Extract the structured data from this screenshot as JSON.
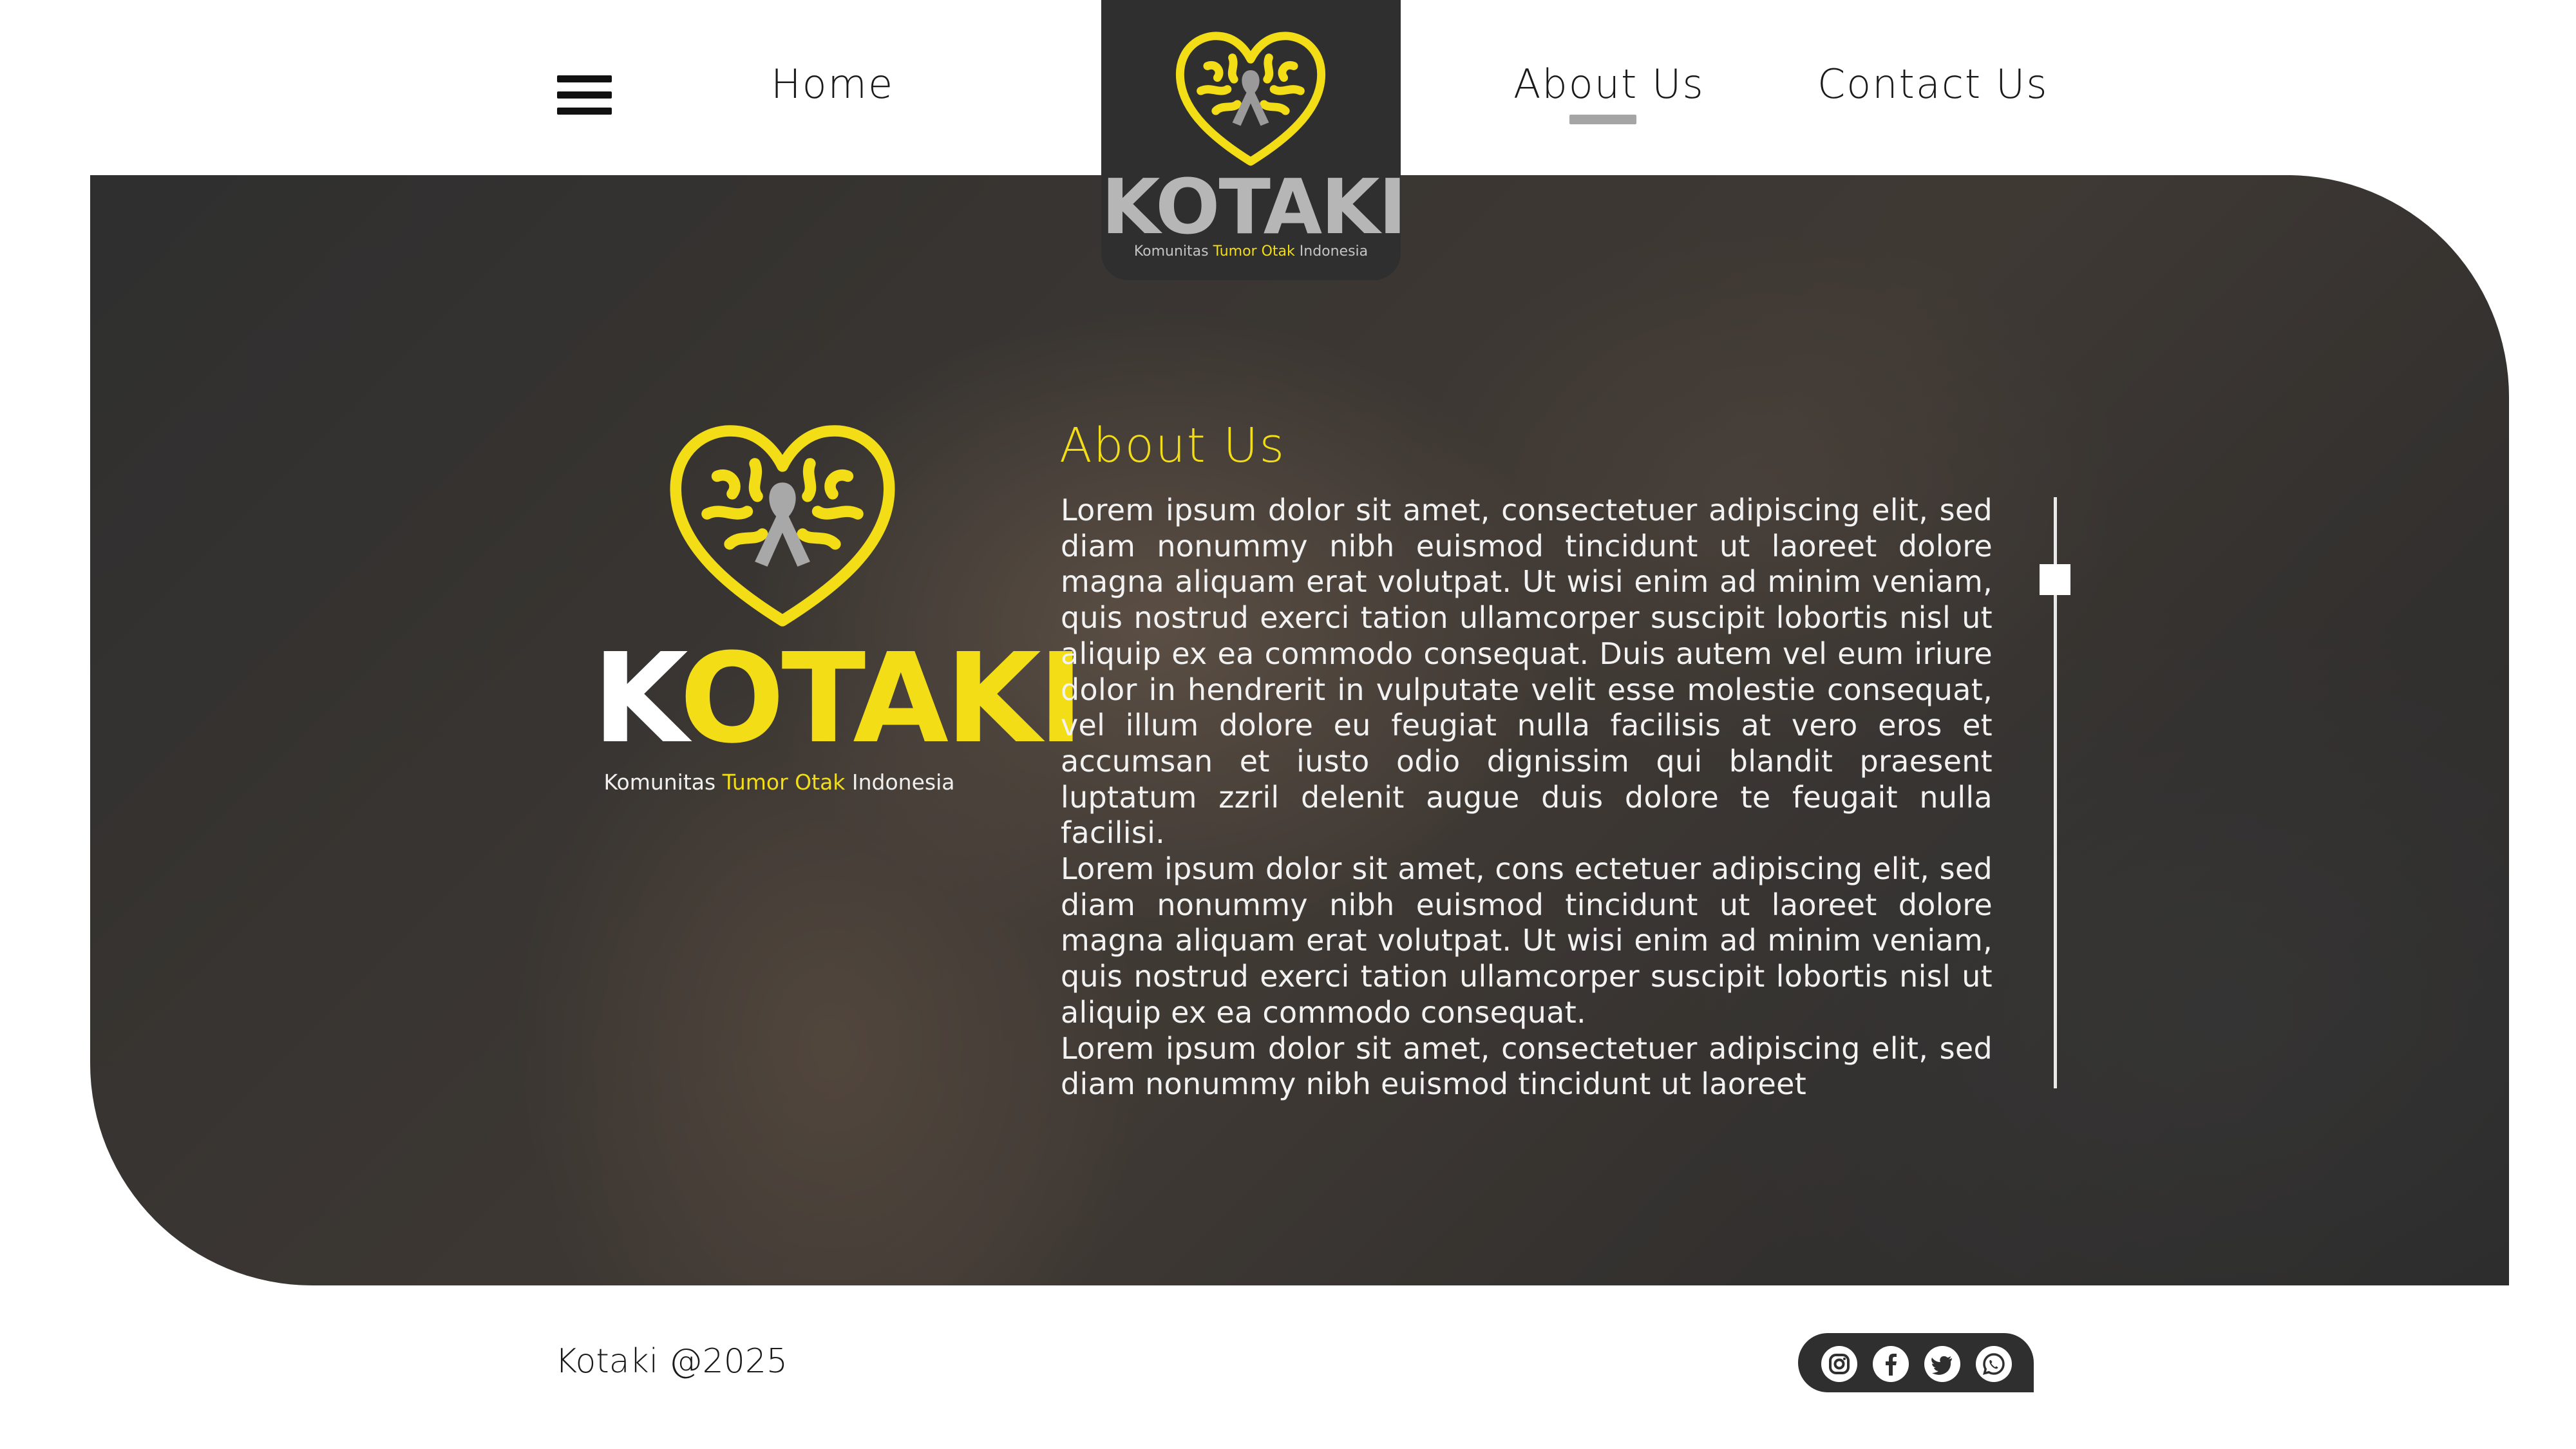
{
  "nav": {
    "menu_icon": "hamburger-menu-icon",
    "home": "Home",
    "about": "About Us",
    "contact": "Contact Us",
    "active": "About Us"
  },
  "logo": {
    "icon": "brain-heart-ribbon-logo",
    "wordmark_k": "K",
    "wordmark_rest": "OTAKI",
    "wordmark_full": "KOTAKI",
    "tagline_pre": "Komunitas ",
    "tagline_highlight": "Tumor Otak",
    "tagline_post": " Indonesia"
  },
  "about": {
    "title": "About Us",
    "paragraphs": [
      "Lorem ipsum dolor sit amet, consectetuer adipiscing elit, sed diam nonummy nibh euismod tincidunt ut laoreet dolore magna aliquam erat volutpat. Ut wisi enim ad minim veniam, quis nostrud exerci tation ullamcorper suscipit lobortis nisl ut aliquip ex ea commodo consequat. Duis autem vel eum iriure dolor in hendrerit in vulputate velit esse molestie consequat, vel illum dolore eu feugiat nulla facilisis at vero eros et accumsan et iusto odio dignissim qui blandit praesent luptatum zzril delenit augue duis dolore te feugait nulla facilisi.",
      "Lorem ipsum dolor sit amet, cons ectetuer adipiscing elit, sed diam nonummy nibh euismod tincidunt ut laoreet dolore magna aliquam erat volutpat. Ut wisi enim ad minim veniam, quis nostrud exerci tation ullamcorper suscipit lobortis nisl ut aliquip ex ea commodo consequat.",
      "Lorem ipsum dolor sit amet, consectetuer adipiscing elit, sed diam nonummy nibh euismod tincidunt ut laoreet"
    ],
    "scroll_position": 0.12
  },
  "footer": {
    "copyright": "Kotaki @2025",
    "social_icons": [
      "instagram-icon",
      "facebook-icon",
      "twitter-icon",
      "whatsapp-icon"
    ]
  },
  "colors": {
    "accent_yellow": "#f2dd17",
    "dark": "#2f2f2f",
    "underline_gray": "#a5a5a5"
  }
}
